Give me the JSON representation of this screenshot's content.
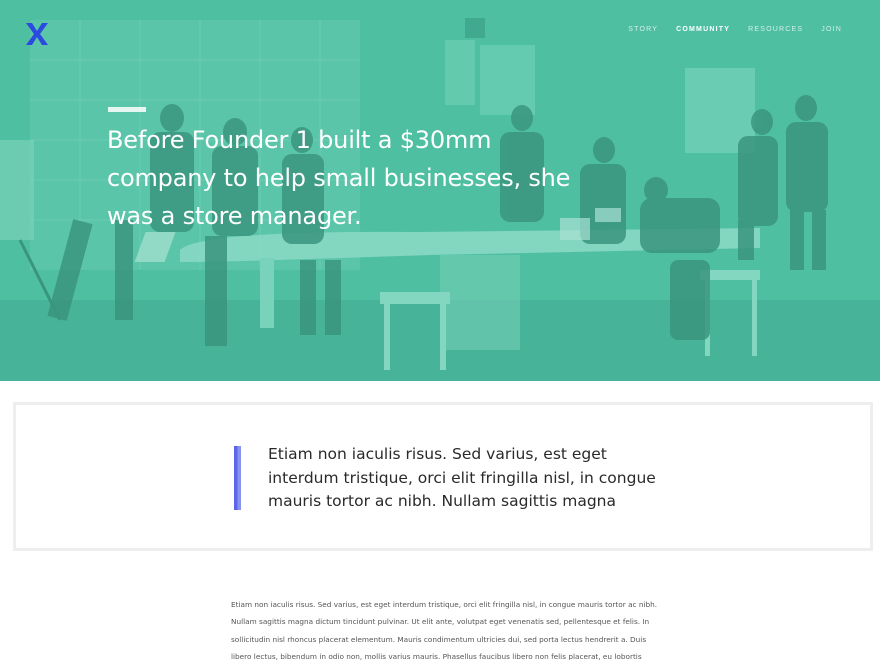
{
  "brand": {
    "logo_letter": "X",
    "logo_color": "#2b4ae0"
  },
  "nav": {
    "items": [
      {
        "label": "STORY",
        "active": false
      },
      {
        "label": "COMMUNITY",
        "active": true
      },
      {
        "label": "RESOURCES",
        "active": false
      },
      {
        "label": "JOIN",
        "active": false
      }
    ]
  },
  "hero": {
    "headline": "Before Founder 1 built a $30mm company to help small businesses, she was a store manager.",
    "tint_color": "#4fbfa2"
  },
  "quote": {
    "text": "Etiam non iaculis risus. Sed varius, est eget interdum tristique, orci elit fringilla nisl, in congue mauris tortor ac nibh. Nullam sagittis magna",
    "bar_color": "#5b67e8"
  },
  "body": {
    "paragraph": "Etiam non iaculis risus. Sed varius, est eget interdum tristique, orci elit fringilla nisl, in congue mauris tortor ac nibh. Nullam sagittis magna dictum tincidunt pulvinar. Ut elit ante, volutpat eget venenatis sed, pellentesque et felis. In sollicitudin nisl rhoncus placerat elementum. Mauris condimentum ultricies dui, sed porta lectus hendrerit a. Duis libero lectus, bibendum in odio non, mollis varius mauris. Phasellus faucibus libero non felis placerat, eu lobortis"
  }
}
